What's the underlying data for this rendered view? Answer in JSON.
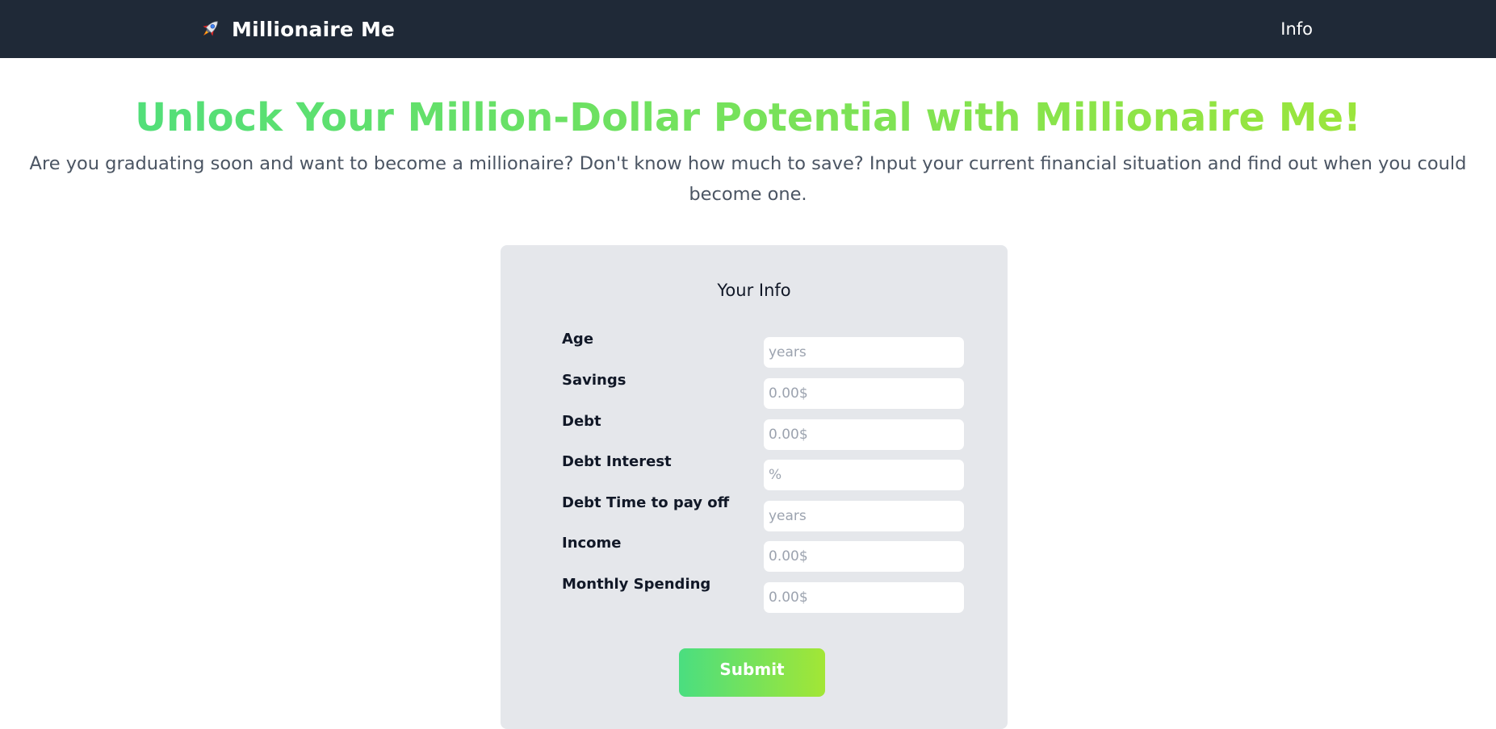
{
  "nav": {
    "brand_name": "Millionaire Me",
    "brand_icon": "rocket-icon",
    "info_link": "Info"
  },
  "hero": {
    "title": "Unlock Your Million-Dollar Potential with Millionaire Me!",
    "subtitle": "Are you graduating soon and want to become a millionaire? Don't know how much to save? Input your current financial situation and find out when you could become one."
  },
  "form": {
    "title": "Your Info",
    "fields": [
      {
        "label": "Age",
        "placeholder": "years",
        "value": ""
      },
      {
        "label": "Savings",
        "placeholder": "0.00$",
        "value": ""
      },
      {
        "label": "Debt",
        "placeholder": "0.00$",
        "value": ""
      },
      {
        "label": "Debt Interest",
        "placeholder": "%",
        "value": ""
      },
      {
        "label": "Debt Time to pay off",
        "placeholder": "years",
        "value": ""
      },
      {
        "label": "Income",
        "placeholder": "0.00$",
        "value": ""
      },
      {
        "label": "Monthly Spending",
        "placeholder": "0.00$",
        "value": ""
      }
    ],
    "submit_label": "Submit"
  },
  "colors": {
    "navbar_bg": "#1f2937",
    "accent_start": "#4ade80",
    "accent_end": "#a3e635",
    "card_bg": "#e5e7eb"
  }
}
